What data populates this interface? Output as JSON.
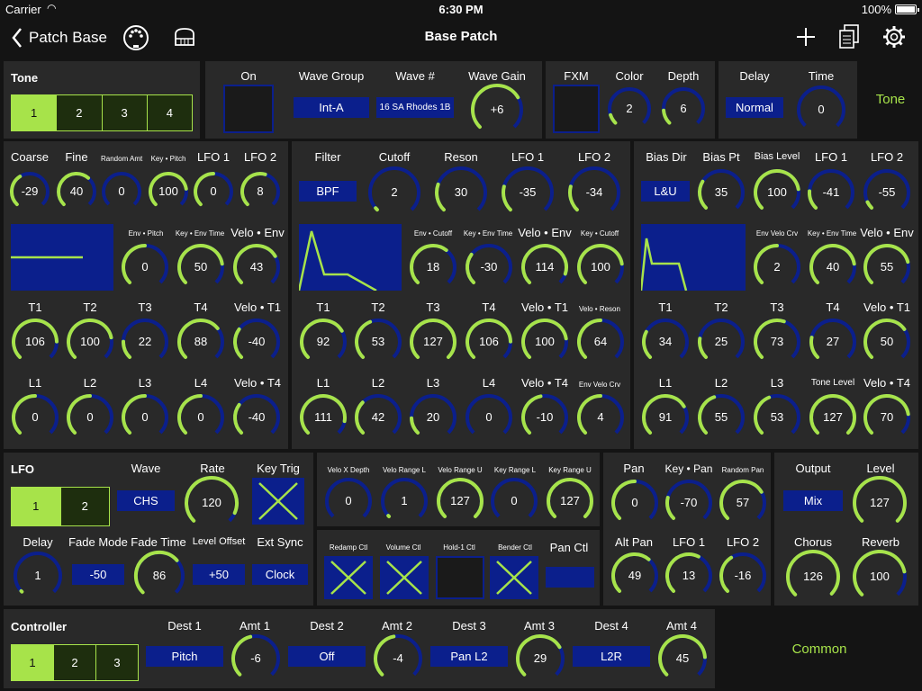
{
  "status": {
    "carrier": "Carrier",
    "time": "6:30 PM",
    "battery": "100%"
  },
  "nav": {
    "back_label": "Patch Base",
    "title": "Base Patch"
  },
  "tone_panel": {
    "title": "Tone",
    "tabs": [
      "1",
      "2",
      "3",
      "4"
    ],
    "side_label": "Tone"
  },
  "tone_top": {
    "on_label": "On",
    "wave_group_label": "Wave Group",
    "wave_group_value": "Int-A",
    "wave_num_label": "Wave #",
    "wave_num_value": "16 SA Rhodes 1B",
    "wave_gain_label": "Wave Gain",
    "wave_gain_value": "+6",
    "fxm_label": "FXM",
    "color_label": "Color",
    "color_value": "2",
    "depth_label": "Depth",
    "depth_value": "6",
    "delay_label": "Delay",
    "delay_value": "Normal",
    "time_label": "Time",
    "time_value": "0"
  },
  "pitch": {
    "coarse": {
      "label": "Coarse",
      "value": "-29"
    },
    "fine": {
      "label": "Fine",
      "value": "40"
    },
    "random_amt": {
      "label": "Random Amt",
      "value": "0"
    },
    "key_pitch": {
      "label": "Key • Pitch",
      "value": "100"
    },
    "lfo1": {
      "label": "LFO 1",
      "value": "0"
    },
    "lfo2": {
      "label": "LFO 2",
      "value": "8"
    },
    "env_pitch": {
      "label": "Env • Pitch",
      "value": "0"
    },
    "key_env_time": {
      "label": "Key • Env Time",
      "value": "50"
    },
    "velo_env": {
      "label": "Velo • Env",
      "value": "43"
    },
    "t1": {
      "label": "T1",
      "value": "106"
    },
    "t2": {
      "label": "T2",
      "value": "100"
    },
    "t3": {
      "label": "T3",
      "value": "22"
    },
    "t4": {
      "label": "T4",
      "value": "88"
    },
    "velo_t1": {
      "label": "Velo • T1",
      "value": "-40"
    },
    "l1": {
      "label": "L1",
      "value": "0"
    },
    "l2": {
      "label": "L2",
      "value": "0"
    },
    "l3": {
      "label": "L3",
      "value": "0"
    },
    "l4": {
      "label": "L4",
      "value": "0"
    },
    "velo_t4": {
      "label": "Velo • T4",
      "value": "-40"
    }
  },
  "filter": {
    "filter": {
      "label": "Filter",
      "value": "BPF"
    },
    "cutoff": {
      "label": "Cutoff",
      "value": "2"
    },
    "reson": {
      "label": "Reson",
      "value": "30"
    },
    "lfo1": {
      "label": "LFO 1",
      "value": "-35"
    },
    "lfo2": {
      "label": "LFO 2",
      "value": "-34"
    },
    "env_cutoff": {
      "label": "Env • Cutoff",
      "value": "18"
    },
    "key_env_time": {
      "label": "Key • Env Time",
      "value": "-30"
    },
    "velo_env": {
      "label": "Velo • Env",
      "value": "114"
    },
    "key_cutoff": {
      "label": "Key • Cutoff",
      "value": "100"
    },
    "t1": {
      "label": "T1",
      "value": "92"
    },
    "t2": {
      "label": "T2",
      "value": "53"
    },
    "t3": {
      "label": "T3",
      "value": "127"
    },
    "t4": {
      "label": "T4",
      "value": "106"
    },
    "velo_t1": {
      "label": "Velo • T1",
      "value": "100"
    },
    "velo_reson": {
      "label": "Velo • Reson",
      "value": "64"
    },
    "l1": {
      "label": "L1",
      "value": "111"
    },
    "l2": {
      "label": "L2",
      "value": "42"
    },
    "l3": {
      "label": "L3",
      "value": "20"
    },
    "l4": {
      "label": "L4",
      "value": "0"
    },
    "velo_t4": {
      "label": "Velo • T4",
      "value": "-10"
    },
    "env_velo_crv": {
      "label": "Env Velo Crv",
      "value": "4"
    }
  },
  "amp": {
    "bias_dir": {
      "label": "Bias Dir",
      "value": "L&U"
    },
    "bias_pt": {
      "label": "Bias Pt",
      "value": "35"
    },
    "bias_level": {
      "label": "Bias Level",
      "value": "100"
    },
    "lfo1": {
      "label": "LFO 1",
      "value": "-41"
    },
    "lfo2": {
      "label": "LFO 2",
      "value": "-55"
    },
    "env_velo_crv": {
      "label": "Env Velo Crv",
      "value": "2"
    },
    "key_env_time": {
      "label": "Key • Env Time",
      "value": "40"
    },
    "velo_env": {
      "label": "Velo • Env",
      "value": "55"
    },
    "t1": {
      "label": "T1",
      "value": "34"
    },
    "t2": {
      "label": "T2",
      "value": "25"
    },
    "t3": {
      "label": "T3",
      "value": "73"
    },
    "t4": {
      "label": "T4",
      "value": "27"
    },
    "velo_t1": {
      "label": "Velo • T1",
      "value": "50"
    },
    "l1": {
      "label": "L1",
      "value": "91"
    },
    "l2": {
      "label": "L2",
      "value": "55"
    },
    "l3": {
      "label": "L3",
      "value": "53"
    },
    "tone_level": {
      "label": "Tone Level",
      "value": "127"
    },
    "velo_t4": {
      "label": "Velo • T4",
      "value": "70"
    }
  },
  "lfo": {
    "title": "LFO",
    "tabs": [
      "1",
      "2"
    ],
    "wave": {
      "label": "Wave",
      "value": "CHS"
    },
    "rate": {
      "label": "Rate",
      "value": "120"
    },
    "key_trig": {
      "label": "Key Trig"
    },
    "delay": {
      "label": "Delay",
      "value": "1"
    },
    "fade_mode": {
      "label": "Fade Mode",
      "value": "-50"
    },
    "fade_time": {
      "label": "Fade Time",
      "value": "86"
    },
    "level_offset": {
      "label": "Level Offset",
      "value": "+50"
    },
    "ext_sync": {
      "label": "Ext Sync",
      "value": "Clock"
    }
  },
  "velo": {
    "x_depth": {
      "label": "Velo X Depth",
      "value": "0"
    },
    "range_l": {
      "label": "Velo Range L",
      "value": "1"
    },
    "range_u": {
      "label": "Velo Range U",
      "value": "127"
    },
    "key_range_l": {
      "label": "Key Range L",
      "value": "0"
    },
    "key_range_u": {
      "label": "Key Range U",
      "value": "127"
    },
    "redamp": {
      "label": "Redamp Ctl"
    },
    "volume": {
      "label": "Volume Ctl"
    },
    "hold1": {
      "label": "Hold-1 Ctl"
    },
    "bender": {
      "label": "Bender Ctl"
    },
    "pan": {
      "label": "Pan Ctl"
    }
  },
  "pan": {
    "pan": {
      "label": "Pan",
      "value": "0"
    },
    "key_pan": {
      "label": "Key • Pan",
      "value": "-70"
    },
    "random_pan": {
      "label": "Random Pan",
      "value": "57"
    },
    "alt_pan": {
      "label": "Alt Pan",
      "value": "49"
    },
    "lfo1": {
      "label": "LFO 1",
      "value": "13"
    },
    "lfo2": {
      "label": "LFO 2",
      "value": "-16"
    }
  },
  "output": {
    "output": {
      "label": "Output",
      "value": "Mix"
    },
    "level": {
      "label": "Level",
      "value": "127"
    },
    "chorus": {
      "label": "Chorus",
      "value": "126"
    },
    "reverb": {
      "label": "Reverb",
      "value": "100"
    }
  },
  "controller": {
    "title": "Controller",
    "tabs": [
      "1",
      "2",
      "3"
    ],
    "dest1": {
      "label": "Dest 1",
      "value": "Pitch"
    },
    "amt1": {
      "label": "Amt 1",
      "value": "-6"
    },
    "dest2": {
      "label": "Dest 2",
      "value": "Off"
    },
    "amt2": {
      "label": "Amt 2",
      "value": "-4"
    },
    "dest3": {
      "label": "Dest 3",
      "value": "Pan L2"
    },
    "amt3": {
      "label": "Amt 3",
      "value": "29"
    },
    "dest4": {
      "label": "Dest 4",
      "value": "L2R"
    },
    "amt4": {
      "label": "Amt 4",
      "value": "45"
    },
    "side_label": "Common"
  },
  "colors": {
    "accent": "#a7e34a",
    "track": "#0b1f8c",
    "panel": "#292929",
    "bg": "#141414"
  }
}
